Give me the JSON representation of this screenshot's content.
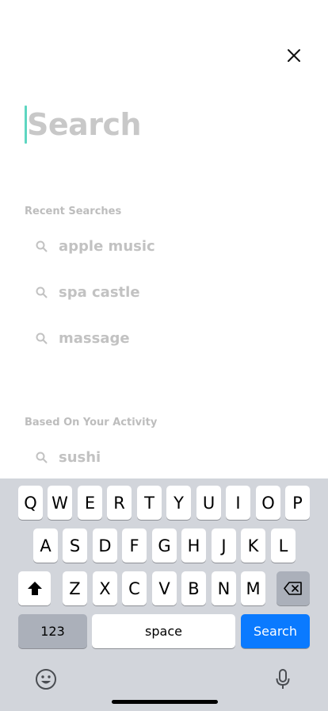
{
  "search": {
    "placeholder": "Search",
    "value": ""
  },
  "recent": {
    "title": "Recent Searches",
    "items": [
      {
        "label": "apple music"
      },
      {
        "label": "spa castle"
      },
      {
        "label": "massage"
      }
    ]
  },
  "activity": {
    "title": "Based On Your Activity",
    "items": [
      {
        "label": "sushi"
      }
    ]
  },
  "keyboard": {
    "row1": [
      "Q",
      "W",
      "E",
      "R",
      "T",
      "Y",
      "U",
      "I",
      "O",
      "P"
    ],
    "row2": [
      "A",
      "S",
      "D",
      "F",
      "G",
      "H",
      "J",
      "K",
      "L"
    ],
    "row3": [
      "Z",
      "X",
      "C",
      "V",
      "B",
      "N",
      "M"
    ],
    "numbers_label": "123",
    "space_label": "space",
    "action_label": "Search"
  },
  "colors": {
    "accent_caret": "#5ed6c1",
    "action_key": "#0a7aff"
  },
  "icons": [
    "close-icon",
    "search-icon",
    "shift-icon",
    "backspace-icon",
    "emoji-icon",
    "microphone-icon"
  ]
}
